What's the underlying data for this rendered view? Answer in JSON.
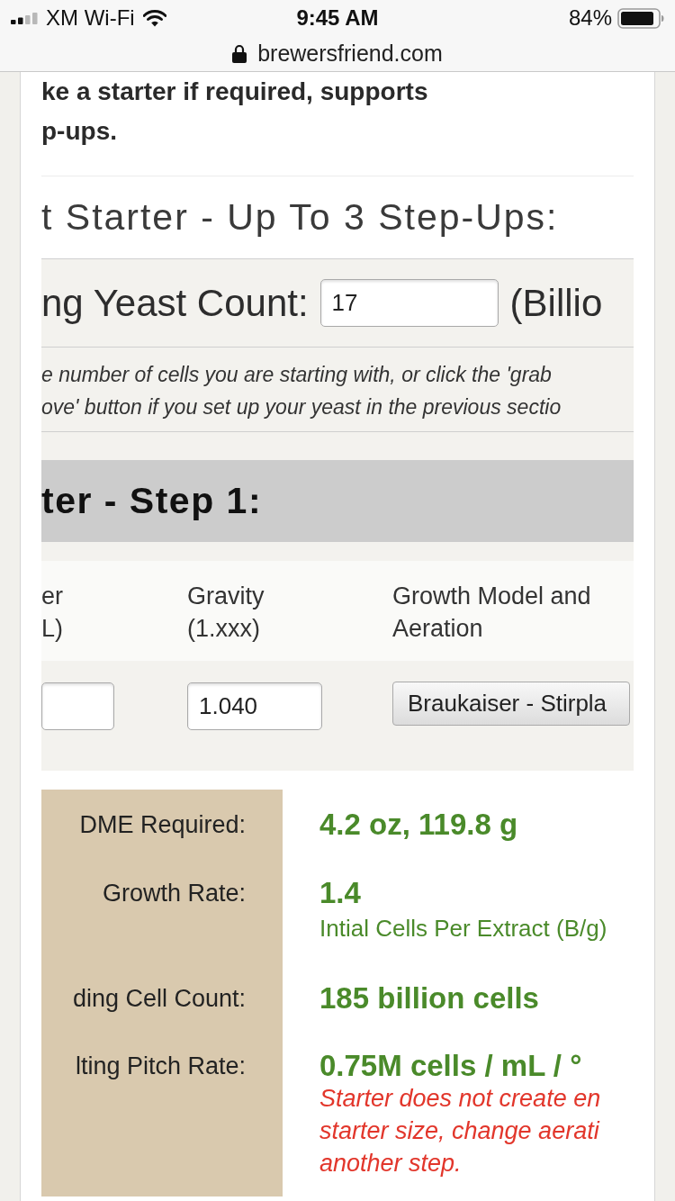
{
  "status_bar": {
    "carrier": "XM Wi-Fi",
    "time": "9:45 AM",
    "battery": "84%"
  },
  "address_bar": {
    "url": "brewersfriend.com"
  },
  "intro": {
    "lines": [
      "ke a starter if required, supports",
      "p-ups."
    ]
  },
  "section_title": "t Starter - Up To 3 Step-Ups:",
  "yeast_count": {
    "label": "ng Yeast Count:",
    "value": "17",
    "unit": "(Billio",
    "help_lines": [
      "e number of cells you are starting with, or click the 'grab",
      "ove' button if you set up your yeast in the previous sectio"
    ]
  },
  "step": {
    "title": "ter - Step 1:",
    "columns": [
      {
        "label_lines": [
          "er",
          "L)"
        ],
        "field": {
          "kind": "input"
        }
      },
      {
        "label_lines": [
          "Gravity",
          "(1.xxx)"
        ],
        "field": {
          "kind": "input",
          "value": "1.040"
        }
      },
      {
        "label_lines": [
          "Growth Model and",
          "Aeration"
        ],
        "field": {
          "kind": "select",
          "value": "Braukaiser - Stirpla"
        }
      }
    ]
  },
  "results": [
    {
      "label": "DME Required:",
      "value": "4.2 oz, 119.8 g"
    },
    {
      "label": "Growth Rate:",
      "value": "1.4",
      "note": "Intial Cells Per Extract (B/g)"
    },
    {
      "label": "ding Cell Count:",
      "value": "185 billion cells"
    },
    {
      "label": "lting Pitch Rate:",
      "value": "0.75M cells / mL / °",
      "warning_lines": [
        "Starter does not create en",
        "starter size, change aerati",
        "another step."
      ]
    }
  ]
}
